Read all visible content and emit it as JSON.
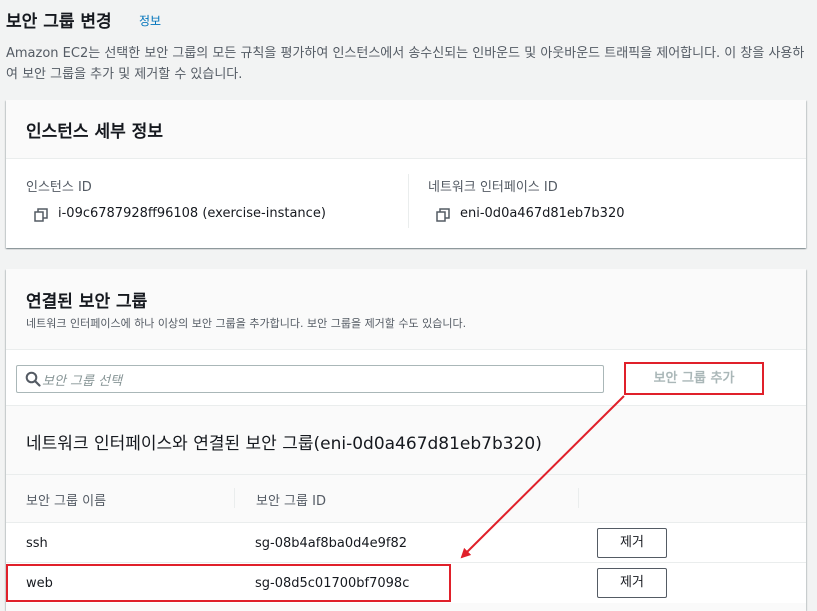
{
  "page": {
    "title": "보안 그룹 변경",
    "info_link": "정보",
    "description": "Amazon EC2는 선택한 보안 그룹의 모든 규칙을 평가하여 인스턴스에서 송수신되는 인바운드 및 아웃바운드 트래픽을 제어합니다. 이 창을 사용하여 보안 그룹을 추가 및 제거할 수 있습니다."
  },
  "instance_details": {
    "title": "인스턴스 세부 정보",
    "instance_id_label": "인스턴스 ID",
    "instance_id_value": "i-09c6787928ff96108 (exercise-instance)",
    "eni_label": "네트워크 인터페이스 ID",
    "eni_value": "eni-0d0a467d81eb7b320"
  },
  "associated_groups": {
    "title": "연결된 보안 그룹",
    "description": "네트워크 인터페이스에 하나 이상의 보안 그룹을 추가합니다. 보안 그룹을 제거할 수도 있습니다.",
    "search_placeholder": "보안 그룹 선택",
    "add_button": "보안 그룹 추가",
    "table_title": "네트워크 인터페이스와 연결된 보안 그룹(eni-0d0a467d81eb7b320)",
    "columns": [
      "보안 그룹 이름",
      "보안 그룹 ID"
    ],
    "rows": [
      {
        "name": "ssh",
        "id": "sg-08b4af8ba0d4e9f82",
        "remove": "제거"
      },
      {
        "name": "web",
        "id": "sg-08d5c01700bf7098c",
        "remove": "제거"
      }
    ]
  },
  "colors": {
    "link": "#0073bb",
    "annotation_red": "#e0202a",
    "page_bg": "#f2f3f3"
  },
  "icons": [
    "copy-icon",
    "search-icon"
  ]
}
